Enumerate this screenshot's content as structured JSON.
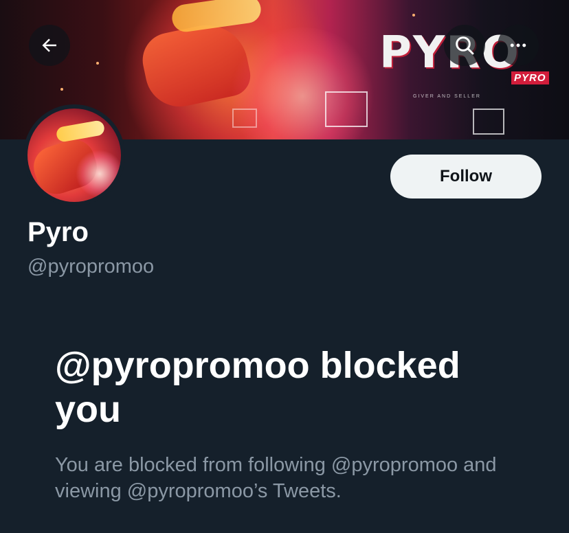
{
  "banner": {
    "brand_text": "PYRO",
    "brand_badge": "PYRO",
    "brand_tagline": "GIVER AND SELLER"
  },
  "nav": {
    "back_icon": "back-arrow-icon",
    "search_icon": "search-icon",
    "more_icon": "more-options-icon"
  },
  "profile": {
    "display_name": "Pyro",
    "handle": "@pyropromoo",
    "follow_label": "Follow"
  },
  "blocked": {
    "title": "@pyropromoo blocked you",
    "description": "You are blocked from following @pyropromoo and viewing @pyropromoo’s Tweets."
  },
  "colors": {
    "background": "#15202b",
    "follow_button_bg": "#eff3f4",
    "secondary_text": "#8b98a5",
    "primary_text": "#ffffff"
  }
}
